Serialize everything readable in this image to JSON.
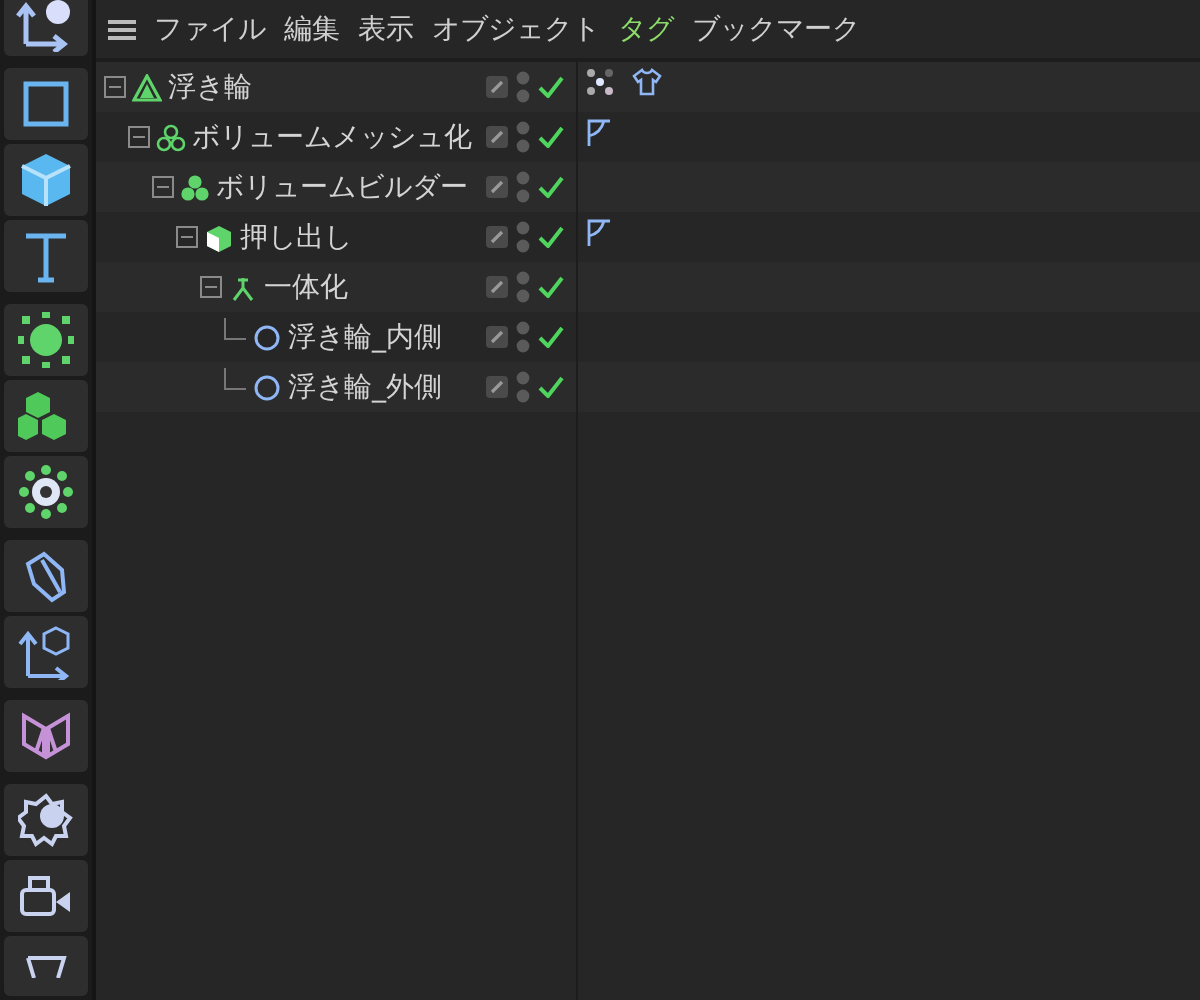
{
  "menu": [
    {
      "label": "ファイル",
      "selected": false
    },
    {
      "label": "編集",
      "selected": false
    },
    {
      "label": "表示",
      "selected": false
    },
    {
      "label": "オブジェクト",
      "selected": false
    },
    {
      "label": "タグ",
      "selected": true
    },
    {
      "label": "ブックマーク",
      "selected": false
    }
  ],
  "objects": [
    {
      "name": "浮き輪",
      "kind": "null",
      "expanded": true,
      "enabled": true,
      "tags": [
        {
          "kind": "points"
        },
        {
          "kind": "shirt"
        }
      ],
      "children": [
        {
          "name": "ボリュームメッシュ化",
          "kind": "volumemesher",
          "expanded": true,
          "enabled": true,
          "tags": [
            {
              "kind": "phong"
            }
          ],
          "children": [
            {
              "name": "ボリュームビルダー",
              "kind": "volumebuilder",
              "expanded": true,
              "enabled": true,
              "children": [
                {
                  "name": "押し出し",
                  "kind": "extrude",
                  "expanded": true,
                  "enabled": true,
                  "tags": [
                    {
                      "kind": "phong"
                    }
                  ],
                  "children": [
                    {
                      "name": "一体化",
                      "kind": "connect",
                      "expanded": true,
                      "enabled": true,
                      "children": [
                        {
                          "name": "浮き輪_内側",
                          "kind": "circle",
                          "enabled": true
                        },
                        {
                          "name": "浮き輪_外側",
                          "kind": "circle",
                          "enabled": true
                        }
                      ]
                    }
                  ]
                }
              ]
            }
          ]
        }
      ]
    }
  ]
}
